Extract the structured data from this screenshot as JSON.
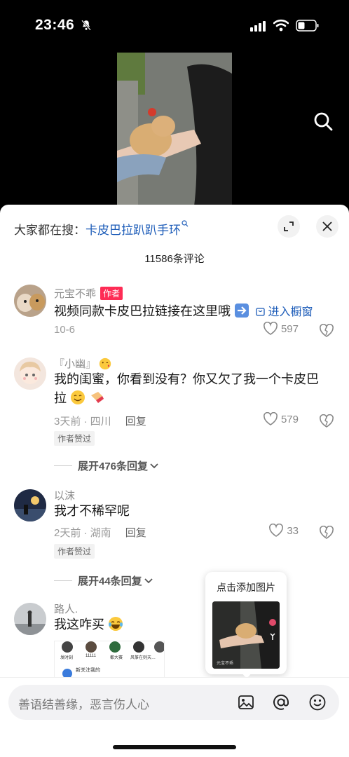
{
  "status_bar": {
    "time": "23:46"
  },
  "sheet": {
    "search_prefix": "大家都在搜：",
    "search_keyword": "卡皮巴拉趴趴手环",
    "comment_count": "11586条评论"
  },
  "comments": [
    {
      "name": "元宝不乖",
      "tag": "作者",
      "text": "视频同款卡皮巴拉链接在这里哦",
      "store_link": "进入橱窗",
      "meta": "10-6",
      "likes": "597"
    },
    {
      "name": "『小幽』",
      "text": "我的闺蜜，你看到没有？你又欠了我一个卡皮巴拉",
      "meta": "3天前 · 四川",
      "reply": "回复",
      "likes": "579",
      "liked_by_author": "作者赞过",
      "expand": "展开476条回复"
    },
    {
      "name": "以沫",
      "text": "我才不稀罕呢",
      "meta": "2天前 · 湖南",
      "reply": "回复",
      "likes": "33",
      "liked_by_author": "作者赞过",
      "expand": "展开44条回复"
    },
    {
      "name": "路人.",
      "text": "我这咋买",
      "thumb_labels": [
        "发时刻",
        "11111",
        "都大赛",
        "风筝在则天…",
        "新关注我的"
      ]
    }
  ],
  "popup": {
    "title": "点击添加图片",
    "thumb_caption": "元宝不乖"
  },
  "input": {
    "placeholder": "善语结善缘，恶言伤人心"
  },
  "icons": {
    "bell": "bell-slash-icon",
    "search": "search-icon",
    "expand": "expand-icon",
    "close": "close-icon",
    "heart": "heart-icon",
    "dislike": "broken-heart-icon",
    "image": "image-icon",
    "at": "at-icon",
    "emoji": "emoji-icon"
  },
  "colors": {
    "accent": "#fe2c55",
    "link": "#1b5bb8"
  }
}
